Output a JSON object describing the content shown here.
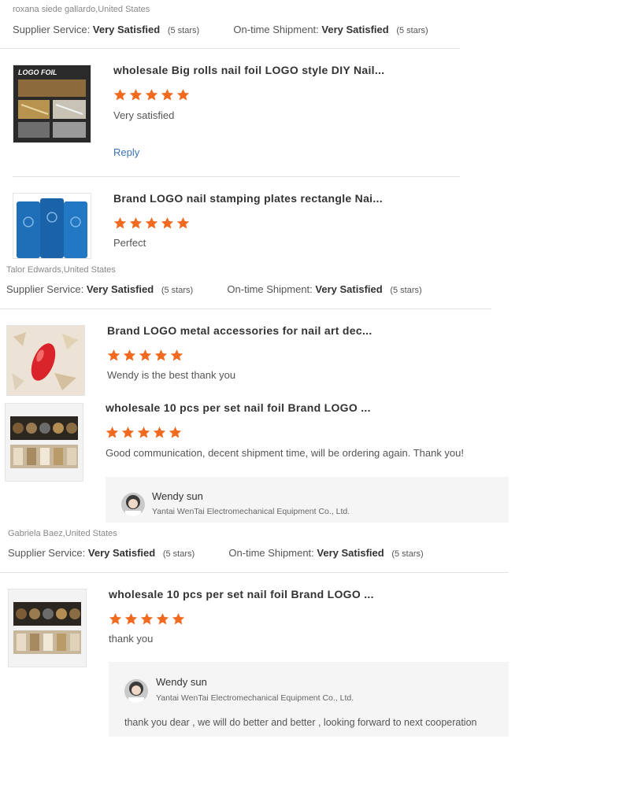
{
  "labels": {
    "supplier_service": "Supplier Service:",
    "ontime_shipment": "On-time Shipment:",
    "very_satisfied": "Very Satisfied",
    "five_stars": "(5 stars)",
    "reply": "Reply"
  },
  "reviews": [
    {
      "reviewer": "roxana siede gallardo,United States",
      "items": [
        {
          "title": "wholesale Big rolls nail foil LOGO style DIY Nail...",
          "stars": 5,
          "comment": "Very satisfied",
          "thumb_text": "LOGO FOIL"
        },
        {
          "title": "Brand LOGO nail stamping plates rectangle Nai...",
          "stars": 5,
          "comment": "Perfect"
        }
      ]
    },
    {
      "reviewer": "Talor Edwards,United States",
      "items": [
        {
          "title": "Brand LOGO metal accessories for nail art dec...",
          "stars": 5,
          "comment": "Wendy is the best thank you"
        },
        {
          "title": "wholesale 10 pcs per set nail foil Brand LOGO ...",
          "stars": 5,
          "comment": "Good communication, decent shipment time, will be ordering again. Thank you!"
        }
      ],
      "seller_reply": {
        "name": "Wendy sun",
        "company": "Yantai WenTai Electromechanical Equipment Co., Ltd.",
        "message": ""
      }
    },
    {
      "reviewer": "Gabriela Baez,United States",
      "items": [
        {
          "title": "wholesale 10 pcs per set nail foil Brand LOGO ...",
          "stars": 5,
          "comment": "thank you"
        }
      ],
      "seller_reply": {
        "name": "Wendy sun",
        "company": "Yantai WenTai Electromechanical Equipment Co., Ltd.",
        "message": "thank you dear , we will do better and better , looking forward to next cooperation"
      }
    }
  ],
  "colors": {
    "star": "#f06a1f",
    "link": "#3b73b9",
    "divider": "#e3e3e3"
  }
}
